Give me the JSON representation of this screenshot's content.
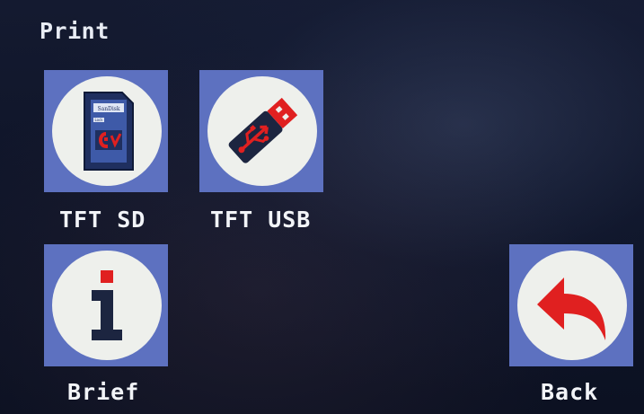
{
  "screen": {
    "title": "Print"
  },
  "tiles": [
    {
      "id": "tft-sd",
      "label": "TFT SD",
      "icon": "sd-card-icon"
    },
    {
      "id": "tft-usb",
      "label": "TFT USB",
      "icon": "usb-drive-icon"
    },
    {
      "id": "brief",
      "label": "Brief",
      "icon": "info-icon"
    },
    {
      "id": "back",
      "label": "Back",
      "icon": "back-arrow-icon"
    }
  ],
  "sd_card_art": {
    "brand": "SanDisk",
    "lock": "Lock"
  },
  "colors": {
    "tile_bg": "#5d71c0",
    "icon_circle": "#eef0ec",
    "accent_red": "#e02020",
    "background": "#0f1529",
    "text": "#f2f4f8"
  }
}
